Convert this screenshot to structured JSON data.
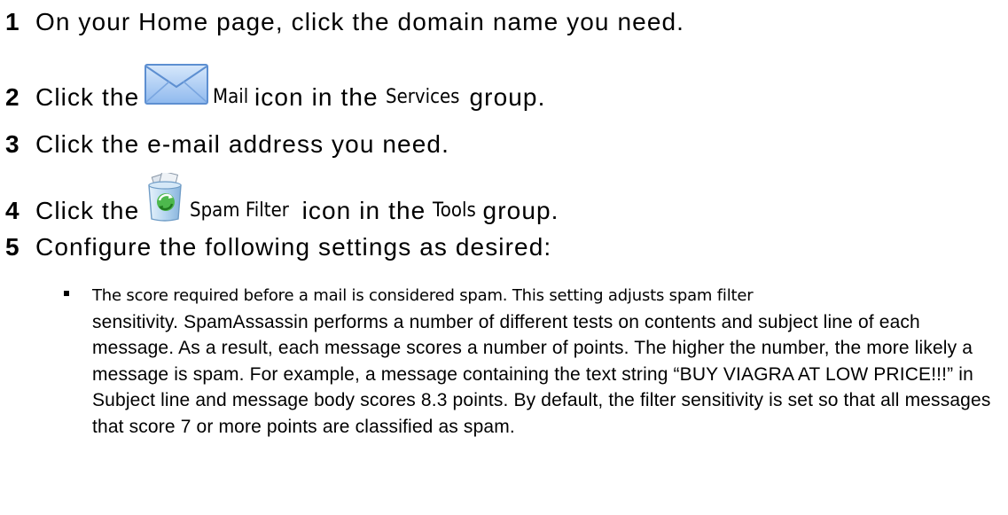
{
  "steps": [
    {
      "num": "1",
      "text": "On your Home page, click the domain name you need."
    },
    {
      "num": "2",
      "before": "Click the",
      "ui_label": "Mail",
      "middle": "icon in the",
      "ui_group": "Services",
      "after": "group.",
      "icon": "mail-envelope-icon"
    },
    {
      "num": "3",
      "text": "Click the e-mail address you need."
    },
    {
      "num": "4",
      "before": "Click the",
      "ui_label": "Spam Filter",
      "middle": "icon in the",
      "ui_group": "Tools",
      "after": "group.",
      "icon": "spam-filter-bin-icon"
    },
    {
      "num": "5",
      "text": "Configure the following settings as desired:"
    }
  ],
  "bullet": {
    "lead": "The score required before a mail is considered spam. This setting adjusts spam filter",
    "body": "sensitivity. SpamAssassin performs a number of different tests on contents and subject line of each message. As a result, each message scores a number of points. The higher the number, the more likely a message is spam. For example, a message containing the text string “BUY VIAGRA AT LOW PRICE!!!” in Subject line and message body scores 8.3 points. By default, the filter sensitivity is set so that all messages that score 7 or more points are classified as spam."
  },
  "colors": {
    "envelope_fill": "#9cc3f2",
    "envelope_edge": "#5d8fd1",
    "bin_body": "#b9d9f2",
    "arrow_green": "#3aa23a"
  }
}
